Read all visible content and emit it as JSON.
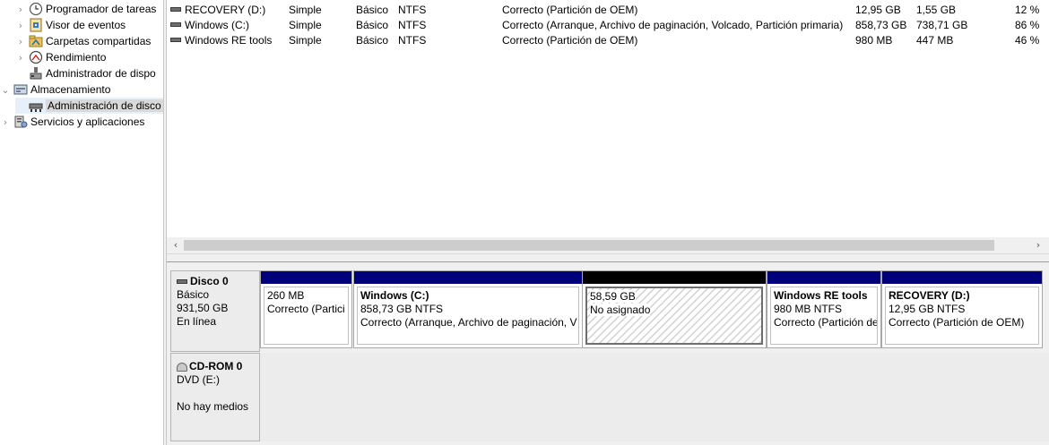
{
  "tree": {
    "items": [
      {
        "label": "Programador de tareas",
        "icon": "clock-icon",
        "chevron": "›"
      },
      {
        "label": "Visor de eventos",
        "icon": "event-viewer-icon",
        "chevron": "›"
      },
      {
        "label": "Carpetas compartidas",
        "icon": "shared-folder-icon",
        "chevron": "›"
      },
      {
        "label": "Rendimiento",
        "icon": "performance-icon",
        "chevron": "›"
      },
      {
        "label": "Administrador de dispo",
        "icon": "device-manager-icon",
        "chevron": ""
      },
      {
        "label": "Almacenamiento",
        "icon": "storage-icon",
        "chevron": "⌄"
      },
      {
        "label": "Administración de disco",
        "icon": "disk-management-icon",
        "chevron": ""
      },
      {
        "label": "Servicios y aplicaciones",
        "icon": "services-icon",
        "chevron": "›"
      }
    ]
  },
  "volumes": [
    {
      "name": "RECOVERY (D:)",
      "layout": "Simple",
      "type": "Básico",
      "fs": "NTFS",
      "status": "Correcto (Partición de OEM)",
      "capacity": "12,95 GB",
      "free": "1,55 GB",
      "pct": "12 %"
    },
    {
      "name": "Windows (C:)",
      "layout": "Simple",
      "type": "Básico",
      "fs": "NTFS",
      "status": "Correcto (Arranque, Archivo de paginación, Volcado, Partición primaria)",
      "capacity": "858,73 GB",
      "free": "738,71 GB",
      "pct": "86 %"
    },
    {
      "name": "Windows RE tools",
      "layout": "Simple",
      "type": "Básico",
      "fs": "NTFS",
      "status": "Correcto (Partición de OEM)",
      "capacity": "980 MB",
      "free": "447 MB",
      "pct": "46 %"
    }
  ],
  "scroll": {
    "left": "‹",
    "right": "›"
  },
  "disk0": {
    "name": "Disco 0",
    "type": "Básico",
    "size": "931,50 GB",
    "state": "En línea",
    "partitions": [
      {
        "name": "",
        "size": "260 MB",
        "status": "Correcto (Partici"
      },
      {
        "name": "Windows  (C:)",
        "size": "858,73 GB NTFS",
        "status": "Correcto (Arranque, Archivo de paginación, V"
      },
      {
        "name": "",
        "size": "58,59 GB",
        "status": "No asignado"
      },
      {
        "name": "Windows RE tools",
        "size": "980 MB NTFS",
        "status": "Correcto (Partición de"
      },
      {
        "name": "RECOVERY  (D:)",
        "size": "12,95 GB NTFS",
        "status": "Correcto (Partición de OEM)"
      }
    ]
  },
  "cdrom0": {
    "name": "CD-ROM 0",
    "drive": "DVD (E:)",
    "media": "No hay medios"
  },
  "colors": {
    "primary_partition_bar": "#00007a",
    "unallocated_bar": "#000000"
  }
}
